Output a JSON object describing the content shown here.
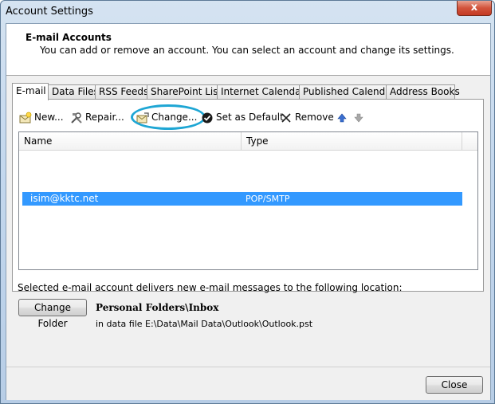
{
  "window": {
    "title": "Account Settings",
    "close_glyph": "x"
  },
  "header": {
    "title": "E-mail Accounts",
    "description": "You can add or remove an account. You can select an account and change its settings."
  },
  "tabs": [
    {
      "label": "E-mail",
      "active": true
    },
    {
      "label": "Data Files"
    },
    {
      "label": "RSS Feeds"
    },
    {
      "label": "SharePoint Lists"
    },
    {
      "label": "Internet Calendars"
    },
    {
      "label": "Published Calendars"
    },
    {
      "label": "Address Books"
    }
  ],
  "toolbar": {
    "new_label": "New...",
    "repair_label": "Repair...",
    "change_label": "Change...",
    "default_label": "Set as Default",
    "remove_label": "Remove",
    "highlight_color": "#1ea6d4"
  },
  "accounts": {
    "columns": [
      "Name",
      "Type"
    ],
    "rows": [
      {
        "name": "isim@kktc.net",
        "type": "POP/SMTP",
        "selected": true
      }
    ],
    "selection_color": "#3399ff"
  },
  "delivery": {
    "text": "Selected e-mail account delivers new e-mail messages to the following location:",
    "change_folder_label": "Change Folder",
    "folder": "Personal Folders\\Inbox",
    "path": "in data file E:\\Data\\Mail Data\\Outlook\\Outlook.pst"
  },
  "footer": {
    "close_label": "Close"
  }
}
